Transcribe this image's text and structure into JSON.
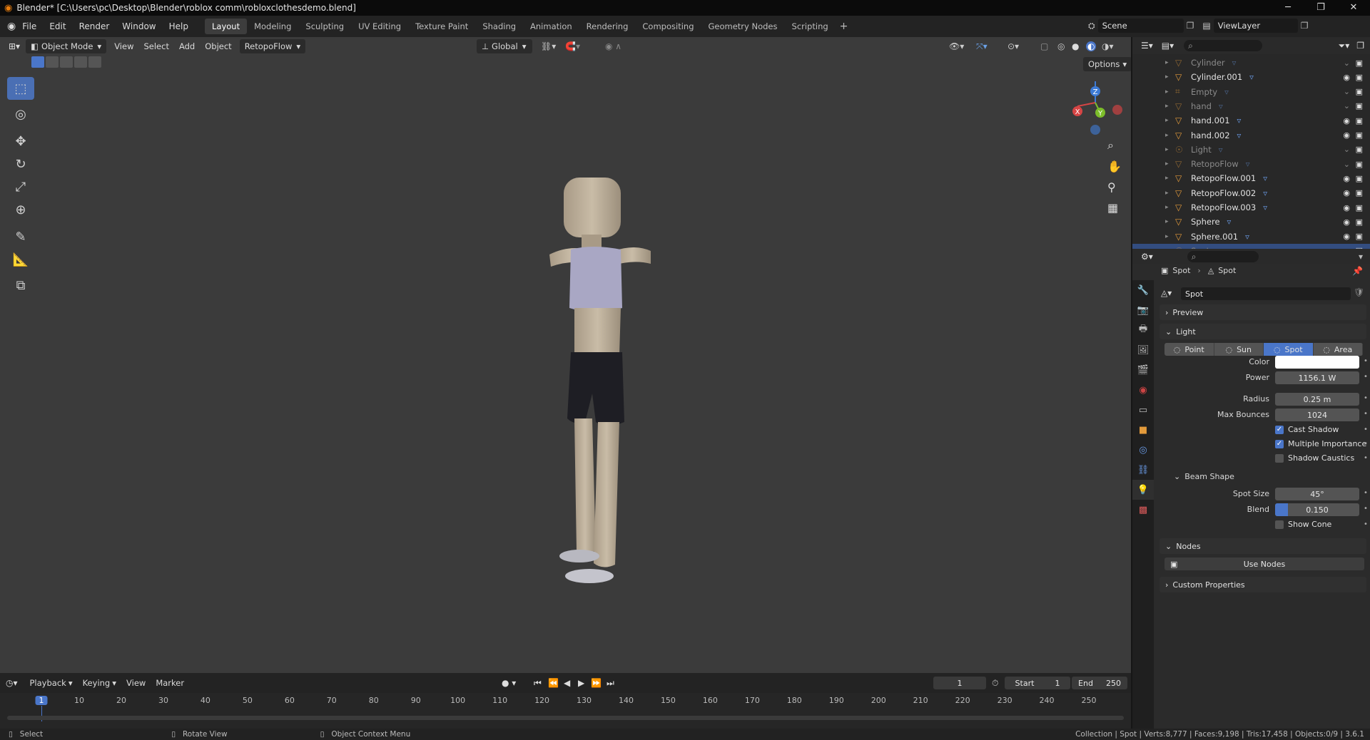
{
  "window": {
    "title": "Blender* [C:\\Users\\pc\\Desktop\\Blender\\roblox comm\\robloxclothesdemo.blend]",
    "minimize": "─",
    "maximize": "❐",
    "close": "✕"
  },
  "menu": [
    "File",
    "Edit",
    "Render",
    "Window",
    "Help"
  ],
  "workspaces": [
    "Layout",
    "Modeling",
    "Sculpting",
    "UV Editing",
    "Texture Paint",
    "Shading",
    "Animation",
    "Rendering",
    "Compositing",
    "Geometry Nodes",
    "Scripting"
  ],
  "workspace_add": "+",
  "scene": {
    "label": "Scene",
    "viewlayer": "ViewLayer"
  },
  "viewport_header": {
    "mode": "Object Mode",
    "view": "View",
    "select": "Select",
    "add": "Add",
    "object": "Object",
    "addon": "RetopoFlow",
    "orientation": "Global",
    "options": "Options"
  },
  "gizmo": {
    "x": "X",
    "y": "Y",
    "z": "Z"
  },
  "outliner": {
    "rows": [
      {
        "name": "Cylinder",
        "dim": true,
        "icon": "mesh-icon"
      },
      {
        "name": "Cylinder.001",
        "dim": false,
        "icon": "mesh-icon"
      },
      {
        "name": "Empty",
        "dim": true,
        "icon": "empty-icon"
      },
      {
        "name": "hand",
        "dim": true,
        "icon": "mesh-icon"
      },
      {
        "name": "hand.001",
        "dim": false,
        "icon": "mesh-icon"
      },
      {
        "name": "hand.002",
        "dim": false,
        "icon": "mesh-icon"
      },
      {
        "name": "Light",
        "dim": true,
        "icon": "light-icon"
      },
      {
        "name": "RetopoFlow",
        "dim": true,
        "icon": "mesh-icon"
      },
      {
        "name": "RetopoFlow.001",
        "dim": false,
        "icon": "mesh-icon"
      },
      {
        "name": "RetopoFlow.002",
        "dim": false,
        "icon": "mesh-icon"
      },
      {
        "name": "RetopoFlow.003",
        "dim": false,
        "icon": "mesh-icon"
      },
      {
        "name": "Sphere",
        "dim": false,
        "icon": "mesh-icon"
      },
      {
        "name": "Sphere.001",
        "dim": false,
        "icon": "mesh-icon"
      },
      {
        "name": "Spot",
        "dim": true,
        "icon": "light-icon",
        "selected": true
      }
    ]
  },
  "properties": {
    "breadcrumb": [
      "Spot",
      "Spot"
    ],
    "datablock": "Spot",
    "preview": "Preview",
    "light_section": "Light",
    "light_types": [
      "Point",
      "Sun",
      "Spot",
      "Area"
    ],
    "active_type": "Spot",
    "color_label": "Color",
    "power_label": "Power",
    "power": "1156.1 W",
    "radius_label": "Radius",
    "radius": "0.25 m",
    "bounces_label": "Max Bounces",
    "bounces": "1024",
    "cast_shadow": "Cast Shadow",
    "multiple_importance": "Multiple Importance",
    "shadow_caustics": "Shadow Caustics",
    "beam_shape": "Beam Shape",
    "spot_size_label": "Spot Size",
    "spot_size": "45°",
    "blend_label": "Blend",
    "blend": "0.150",
    "blend_fraction": 0.15,
    "show_cone": "Show Cone",
    "nodes": "Nodes",
    "use_nodes": "Use Nodes",
    "custom_properties": "Custom Properties"
  },
  "timeline": {
    "playback": "Playback",
    "keying": "Keying",
    "view": "View",
    "marker": "Marker",
    "current_frame": "1",
    "start_label": "Start",
    "start": "1",
    "end_label": "End",
    "end": "250",
    "ruler": [
      "1",
      "10",
      "20",
      "30",
      "40",
      "50",
      "60",
      "70",
      "80",
      "90",
      "100",
      "110",
      "120",
      "130",
      "140",
      "150",
      "160",
      "170",
      "180",
      "190",
      "200",
      "210",
      "220",
      "230",
      "240",
      "250"
    ]
  },
  "statusbar": {
    "select": "Select",
    "rotate": "Rotate View",
    "context": "Object Context Menu",
    "stats": "Collection | Spot | Verts:8,777 | Faces:9,198 | Tris:17,458 | Objects:0/9 | 3.6.1"
  },
  "colors": {
    "accent": "#4a76c9",
    "selected_row": "#334d80",
    "viewport_bg": "#3b3b3b",
    "light_color": "#ffffff"
  }
}
